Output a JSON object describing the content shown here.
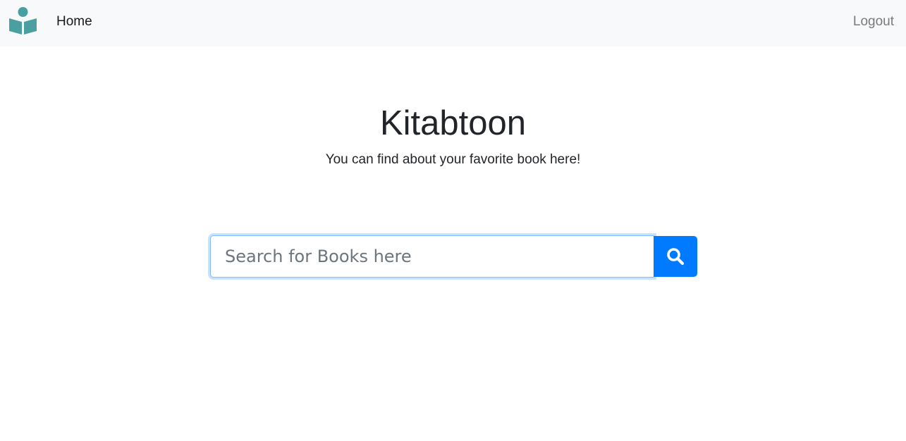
{
  "navbar": {
    "logo_icon": "reading-person-icon",
    "home_label": "Home",
    "logout_label": "Logout"
  },
  "hero": {
    "title": "Kitabtoon",
    "subtitle": "You can find about your favorite book here!"
  },
  "search": {
    "placeholder": "Search for Books here",
    "value": "",
    "button_icon": "search-icon"
  },
  "colors": {
    "navbar_bg": "#f8f9fa",
    "logo": "#4a9fa0",
    "primary": "#007bff",
    "input_focus_border": "#80bdff"
  }
}
